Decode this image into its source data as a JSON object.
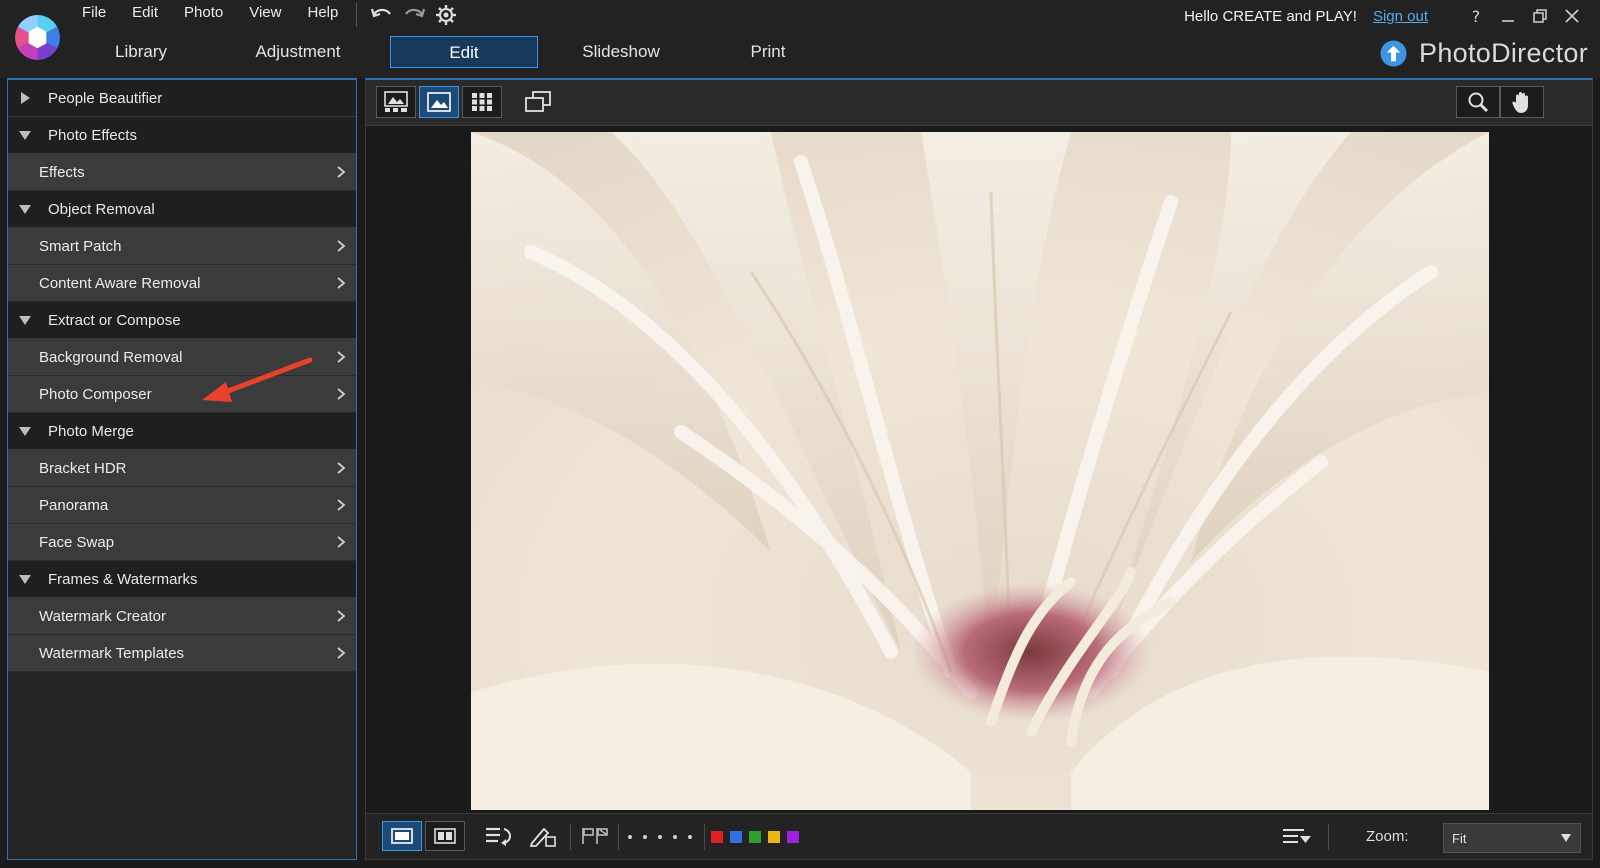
{
  "menu": [
    "File",
    "Edit",
    "Photo",
    "View",
    "Help"
  ],
  "mode_tabs": [
    {
      "label": "Library",
      "active": false
    },
    {
      "label": "Adjustment",
      "active": false
    },
    {
      "label": "Edit",
      "active": true
    },
    {
      "label": "Slideshow",
      "active": false
    },
    {
      "label": "Print",
      "active": false
    }
  ],
  "user": {
    "greeting": "Hello CREATE and PLAY!",
    "sign_out": "Sign out",
    "help": "?"
  },
  "brand": {
    "name": "PhotoDirector",
    "icon": "upload-arrow-circle-icon",
    "accent": "#3b95e0"
  },
  "sidebar": {
    "sections": [
      {
        "label": "People Beautifier",
        "expanded": false,
        "items": []
      },
      {
        "label": "Photo Effects",
        "expanded": true,
        "items": [
          "Effects"
        ]
      },
      {
        "label": "Object Removal",
        "expanded": true,
        "items": [
          "Smart Patch",
          "Content Aware Removal"
        ]
      },
      {
        "label": "Extract or Compose",
        "expanded": true,
        "items": [
          "Background Removal",
          "Photo Composer"
        ]
      },
      {
        "label": "Photo Merge",
        "expanded": true,
        "items": [
          "Bracket HDR",
          "Panorama",
          "Face Swap"
        ]
      },
      {
        "label": "Frames & Watermarks",
        "expanded": true,
        "items": [
          "Watermark Creator",
          "Watermark Templates"
        ]
      }
    ],
    "annotation_color": "#e8412c"
  },
  "viewer": {
    "view_mode_icons": [
      "viewer-with-filmstrip-icon",
      "single-photo-view-icon",
      "grid-view-icon",
      "compare-icon"
    ],
    "active_view": "single-photo-view-icon",
    "right_tools": [
      "zoom-magnifier-icon",
      "pan-hand-icon"
    ]
  },
  "bottom": {
    "color_labels": [
      "#e02020",
      "#2f6fe0",
      "#2ea02e",
      "#e8b814",
      "#a020e0"
    ],
    "zoom_label": "Zoom:",
    "zoom_value": "Fit"
  }
}
